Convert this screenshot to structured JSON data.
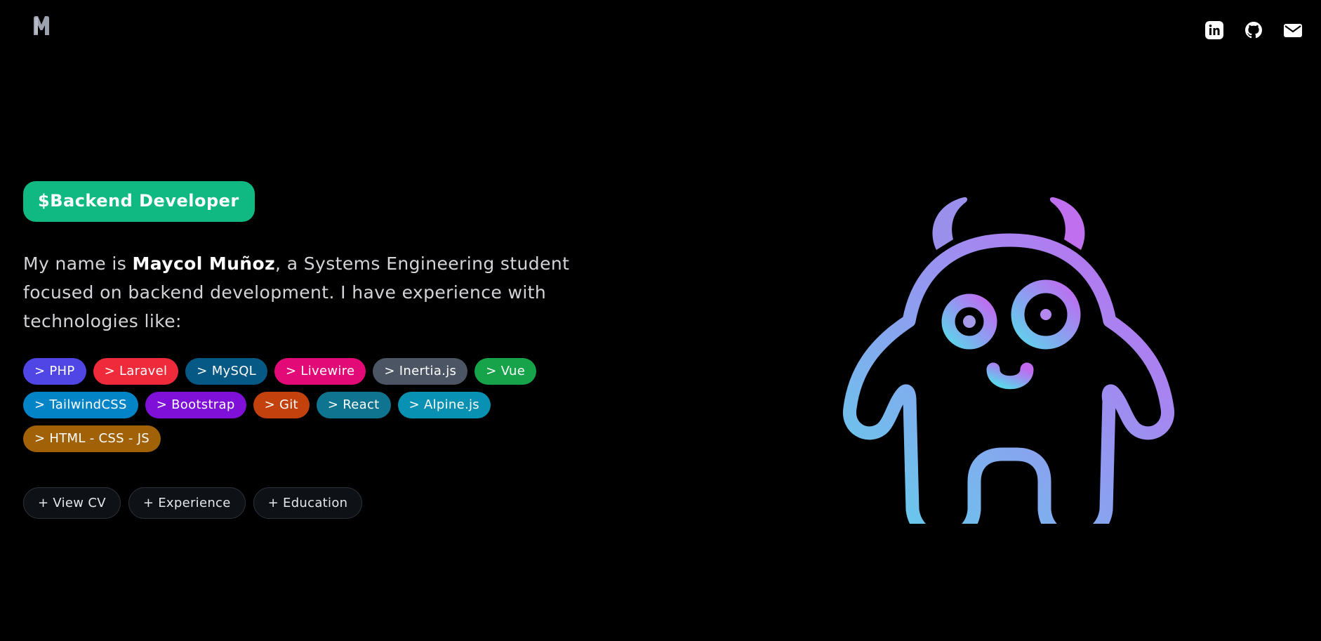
{
  "header": {
    "logo_icon": "m-logo-icon",
    "social": [
      {
        "name": "linkedin-icon"
      },
      {
        "name": "github-icon"
      },
      {
        "name": "mail-icon"
      }
    ]
  },
  "hero": {
    "role": "$Backend Developer",
    "intro_pre": "My name is ",
    "intro_name": "Maycol Muñoz",
    "intro_post": ", a Systems Engineering student focused on backend development. I have experience with technologies like:"
  },
  "tags": [
    {
      "label": "> PHP",
      "color": "#4f46e5"
    },
    {
      "label": "> Laravel",
      "color": "#ef2b3b"
    },
    {
      "label": "> MySQL",
      "color": "#075985"
    },
    {
      "label": "> Livewire",
      "color": "#e20a76"
    },
    {
      "label": "> Inertia.js",
      "color": "#4b5563"
    },
    {
      "label": "> Vue",
      "color": "#16a34a"
    },
    {
      "label": "> TailwindCSS",
      "color": "#0284c7"
    },
    {
      "label": "> Bootstrap",
      "color": "#7e10d8"
    },
    {
      "label": "> Git",
      "color": "#c2410c"
    },
    {
      "label": "> React",
      "color": "#0e7490"
    },
    {
      "label": "> Alpine.js",
      "color": "#0891b2"
    },
    {
      "label": "> HTML - CSS - JS",
      "color": "#a16207"
    }
  ],
  "actions": [
    {
      "label": "+ View CV"
    },
    {
      "label": "+ Experience"
    },
    {
      "label": "+ Education"
    }
  ],
  "illustration": {
    "name": "monster-illustration",
    "gradient": [
      "#5ed4ea",
      "#c26af0"
    ]
  }
}
